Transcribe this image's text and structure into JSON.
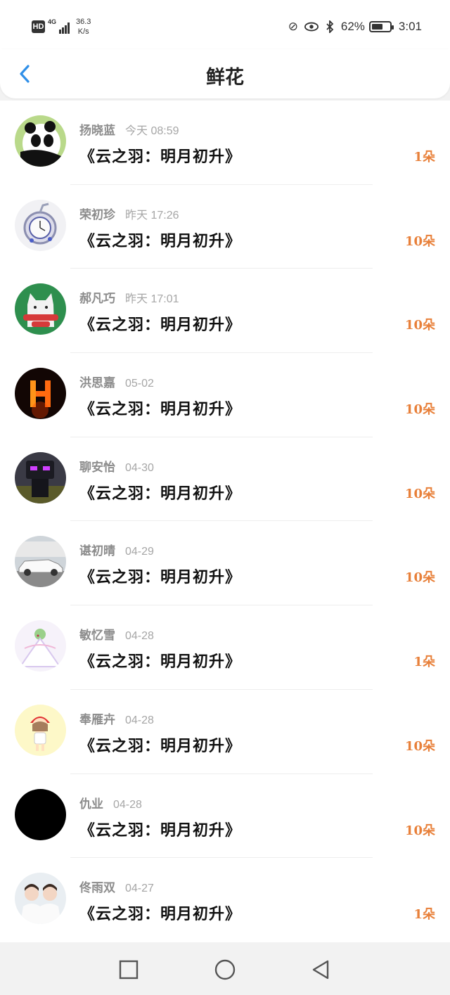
{
  "status_bar": {
    "hd": "HD",
    "net_type": "4G",
    "speed_value": "36.3",
    "speed_unit": "K/s",
    "battery_percent": "62%",
    "battery_level": 0.62,
    "time": "3:01"
  },
  "header": {
    "title": "鲜花"
  },
  "accent_color": "#e8803a",
  "items": [
    {
      "name": "扬晓蓝",
      "time": "今天 08:59",
      "book": "《云之羽：明月初升》",
      "count": "1朵",
      "avatar": "panda-avatar"
    },
    {
      "name": "荣初珍",
      "time": "昨天 17:26",
      "book": "《云之羽：明月初升》",
      "count": "10朵",
      "avatar": "pocket-watch-avatar"
    },
    {
      "name": "郝凡巧",
      "time": "昨天 17:01",
      "book": "《云之羽：明月初升》",
      "count": "10朵",
      "avatar": "cat-avatar"
    },
    {
      "name": "洪思嘉",
      "time": "05-02",
      "book": "《云之羽：明月初升》",
      "count": "10朵",
      "avatar": "fire-letter-avatar"
    },
    {
      "name": "聊安怡",
      "time": "04-30",
      "book": "《云之羽：明月初升》",
      "count": "10朵",
      "avatar": "robot-avatar"
    },
    {
      "name": "谌初晴",
      "time": "04-29",
      "book": "《云之羽：明月初升》",
      "count": "10朵",
      "avatar": "car-avatar"
    },
    {
      "name": "敏忆雪",
      "time": "04-28",
      "book": "《云之羽：明月初升》",
      "count": "1朵",
      "avatar": "fairy-avatar"
    },
    {
      "name": "奉雁卉",
      "time": "04-28",
      "book": "《云之羽：明月初升》",
      "count": "10朵",
      "avatar": "girl-cartoon-avatar"
    },
    {
      "name": "仇业",
      "time": "04-28",
      "book": "《云之羽：明月初升》",
      "count": "10朵",
      "avatar": "black-avatar"
    },
    {
      "name": "佟雨双",
      "time": "04-27",
      "book": "《云之羽：明月初升》",
      "count": "1朵",
      "avatar": "couple-avatar"
    }
  ],
  "nav": {
    "home_icon": "square-icon",
    "circle_icon": "circle-icon",
    "back_icon": "triangle-back-icon"
  }
}
